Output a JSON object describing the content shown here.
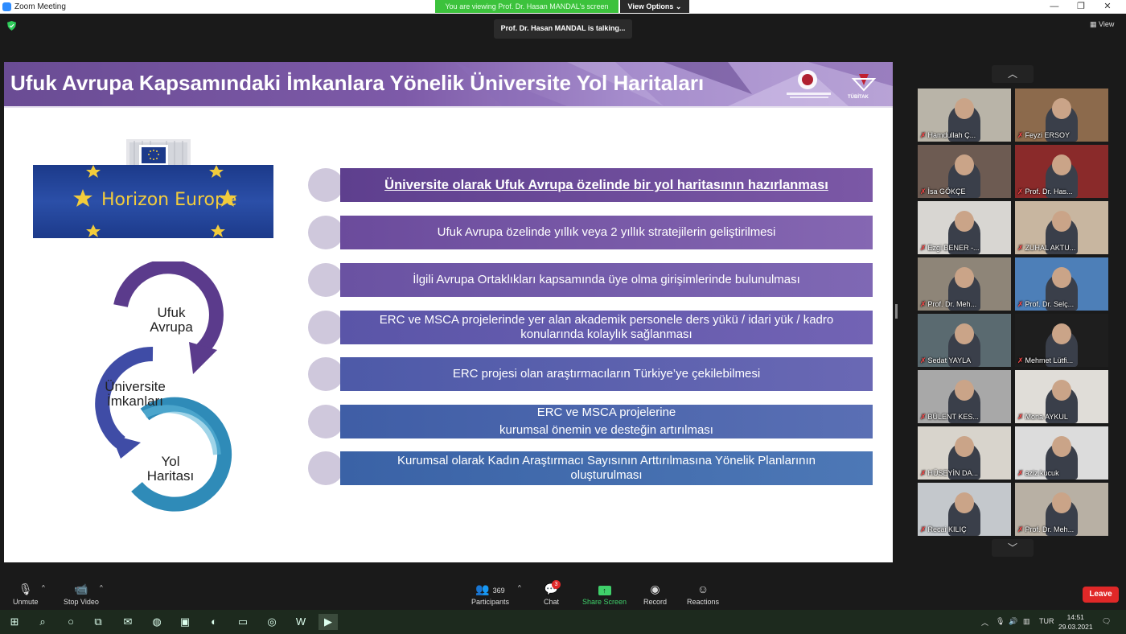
{
  "window": {
    "title": "Zoom Meeting",
    "minimize": "—",
    "restore": "❐",
    "close": "✕"
  },
  "share_banner": "You are viewing Prof. Dr. Hasan MANDAL's screen",
  "view_options": "View Options ⌄",
  "talking": "Prof. Dr. Hasan MANDAL is talking...",
  "view_button": "▦ View",
  "slide": {
    "title": "Ufuk Avrupa Kapsamındaki İmkanlara Yönelik Üniversite Yol Haritaları",
    "flag_text": "Horizon Europe",
    "logo_text_1": "TÜBİTAK",
    "cycle": [
      {
        "line1": "Ufuk",
        "line2": "Avrupa"
      },
      {
        "line1": "Üniversite",
        "line2": "İmkanları"
      },
      {
        "line1": "Yol",
        "line2": "Haritası"
      }
    ],
    "items": [
      {
        "line1": "Üniversite olarak Ufuk Avrupa özelinde bir yol haritasının hazırlanması",
        "line2": ""
      },
      {
        "line1": "Ufuk Avrupa özelinde yıllık veya 2 yıllık stratejilerin geliştirilmesi",
        "line2": ""
      },
      {
        "line1": "İlgili Avrupa Ortaklıkları kapsamında üye olma girişimlerinde bulunulması",
        "line2": ""
      },
      {
        "line1": "ERC ve MSCA projelerinde yer alan akademik personele ders yükü / idari yük / kadro",
        "line2": "konularında kolaylık sağlanması"
      },
      {
        "line1": "ERC projesi olan araştırmacıların Türkiye’ye çekilebilmesi",
        "line2": ""
      },
      {
        "line1": "ERC ve MSCA projelerine",
        "line2": "kurumsal önemin ve desteğin artırılması"
      },
      {
        "line1": "Kurumsal olarak Kadın Araştırmacı Sayısının Arttırılmasına Yönelik Planlarının",
        "line2": "oluşturulması"
      }
    ]
  },
  "participants": [
    {
      "name": "Hamdullah Ç..."
    },
    {
      "name": "Feyzi ERSOY"
    },
    {
      "name": "İsa GÖKÇE"
    },
    {
      "name": "Prof. Dr. Has..."
    },
    {
      "name": "Ezgi BENER -..."
    },
    {
      "name": "ZUHAL AKTU..."
    },
    {
      "name": "Prof. Dr. Meh..."
    },
    {
      "name": "Prof. Dr. Selç..."
    },
    {
      "name": "Sedat YAYLA"
    },
    {
      "name": "Mehmet Lütfi..."
    },
    {
      "name": "BÜLENT KES..."
    },
    {
      "name": "Mona AYKUL"
    },
    {
      "name": "HÜSEYİN DA..."
    },
    {
      "name": "aziz.kucuk"
    },
    {
      "name": "Recai KILIÇ"
    },
    {
      "name": "Prof. Dr. Meh..."
    }
  ],
  "toolbar": {
    "unmute": "Unmute",
    "stop_video": "Stop Video",
    "participants": "Participants",
    "participants_count": "369",
    "chat": "Chat",
    "chat_badge": "3",
    "share_screen": "Share Screen",
    "record": "Record",
    "reactions": "Reactions",
    "leave": "Leave"
  },
  "taskbar": {
    "lang": "TUR",
    "time": "14:51",
    "date": "29.03.2021"
  },
  "colors": {
    "share_green": "#3cc23c",
    "leave_red": "#e02828",
    "header_purple": "#6a4c94"
  }
}
